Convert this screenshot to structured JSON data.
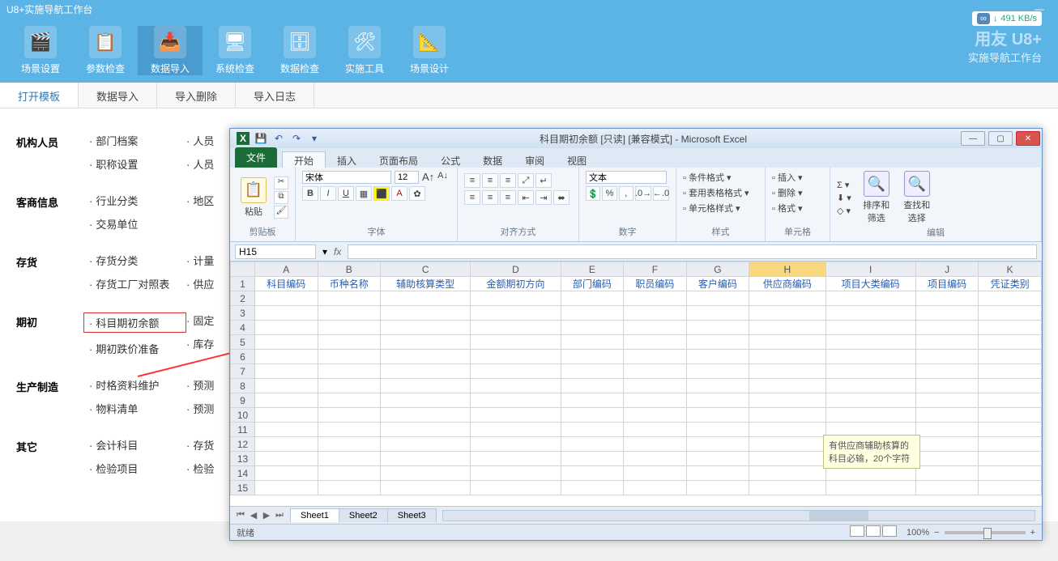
{
  "u8": {
    "title": "U8+实施导航工作台",
    "speed": "491 KB/s",
    "brand_big": "用友 U8+",
    "brand_sub": "实施导航工作台",
    "ribbon": [
      {
        "label": "场景设置",
        "icon": "🎬"
      },
      {
        "label": "参数检查",
        "icon": "📋"
      },
      {
        "label": "数据导入",
        "icon": "📥",
        "active": true
      },
      {
        "label": "系统检查",
        "icon": "🖥"
      },
      {
        "label": "数据检查",
        "icon": "🗄"
      },
      {
        "label": "实施工具",
        "icon": "🛠"
      },
      {
        "label": "场景设计",
        "icon": "📐"
      }
    ],
    "tabs": [
      "打开模板",
      "数据导入",
      "导入删除",
      "导入日志"
    ],
    "rows": [
      {
        "cat": "机构人员",
        "cols": [
          [
            "部门档案",
            "职称设置"
          ],
          [
            "人员",
            "人员"
          ]
        ]
      },
      {
        "cat": "客商信息",
        "cols": [
          [
            "行业分类",
            "交易单位"
          ],
          [
            "地区"
          ]
        ]
      },
      {
        "cat": "存货",
        "cols": [
          [
            "存货分类",
            "存货工厂对照表"
          ],
          [
            "计量",
            "供应"
          ]
        ]
      },
      {
        "cat": "期初",
        "cols": [
          [
            "科目期初余额",
            "期初跌价准备"
          ],
          [
            "固定",
            "库存"
          ]
        ],
        "hilite_idx": 0
      },
      {
        "cat": "生产制造",
        "cols": [
          [
            "时格资料维护",
            "物料清单"
          ],
          [
            "预测",
            "预测"
          ]
        ]
      },
      {
        "cat": "其它",
        "cols": [
          [
            "会计科目",
            "检验项目"
          ],
          [
            "存货",
            "检验"
          ]
        ]
      }
    ]
  },
  "excel": {
    "title": "科目期初余额 [只读] [兼容模式] - Microsoft Excel",
    "file_btn": "文件",
    "ribtabs": [
      "开始",
      "插入",
      "页面布局",
      "公式",
      "数据",
      "审阅",
      "视图"
    ],
    "groups": {
      "clipboard": "剪贴板",
      "paste": "粘贴",
      "font": "字体",
      "font_name": "宋体",
      "font_size": "12",
      "align": "对齐方式",
      "number": "数字",
      "number_fmt": "文本",
      "styles": "样式",
      "style_items": [
        "条件格式",
        "套用表格格式",
        "单元格样式"
      ],
      "cells": "单元格",
      "cell_items": [
        "插入",
        "删除",
        "格式"
      ],
      "editing": "编辑",
      "edit_items": [
        "排序和筛选",
        "查找和选择"
      ]
    },
    "namebox": "H15",
    "cols": [
      "A",
      "B",
      "C",
      "D",
      "E",
      "F",
      "G",
      "H",
      "I",
      "J",
      "K"
    ],
    "selected_col": "H",
    "headers": [
      "科目编码",
      "币种名称",
      "辅助核算类型",
      "金额期初方向",
      "部门编码",
      "职员编码",
      "客户编码",
      "供应商编码",
      "项目大类编码",
      "项目编码",
      "凭证类别"
    ],
    "row_count": 15,
    "tooltip": "有供应商辅助核算的科目必输，20个字符",
    "sheets": [
      "Sheet1",
      "Sheet2",
      "Sheet3"
    ],
    "status": "就绪",
    "zoom": "100%"
  }
}
